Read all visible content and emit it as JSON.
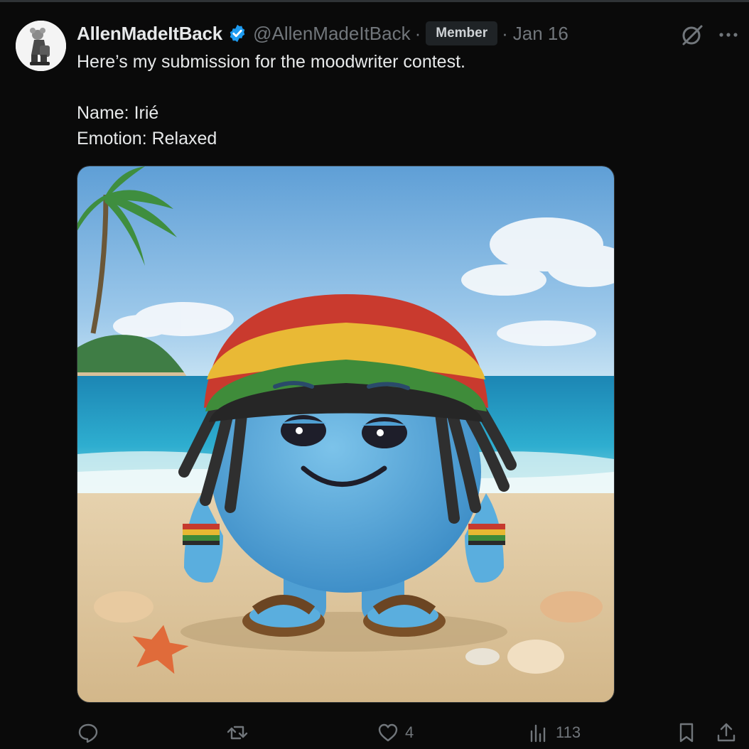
{
  "post": {
    "author_name": "AllenMadeItBack",
    "author_handle": "@AllenMadeItBack",
    "separator": "·",
    "badge": "Member",
    "date": "Jan 16",
    "text_lines": [
      "Here’s my submission for the moodwriter contest.",
      "Name: Irié",
      "Emotion: Relaxed"
    ],
    "media_alt": "Felted blue character in rasta hat on beach",
    "icons": {
      "verified": "verified-badge-icon",
      "grok": "grok-icon",
      "more": "more-icon"
    }
  },
  "actions": {
    "reply_count": "",
    "repost_count": "",
    "like_count": "4",
    "views_count": "113"
  },
  "colors": {
    "background": "#0a0a0a",
    "text": "#e7e9ea",
    "muted": "#71767b",
    "verified": "#1d9bf0",
    "badge_bg": "#1f2326"
  }
}
